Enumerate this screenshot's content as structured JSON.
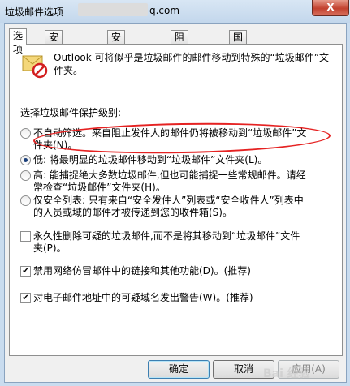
{
  "window": {
    "title": "垃圾邮件选项",
    "title_domain": "q.com",
    "close_label": "X"
  },
  "tabs": [
    {
      "label": "选项"
    },
    {
      "label": "安全发件人"
    },
    {
      "label": "安全收件人"
    },
    {
      "label": "阻止发件人"
    },
    {
      "label": "国际"
    }
  ],
  "intro": {
    "icon": "junk-mail-icon",
    "text": "Outlook 可将似乎是垃圾邮件的邮件移动到特殊的“垃圾邮件”文件夹。"
  },
  "protection": {
    "label": "选择垃圾邮件保护级别:",
    "options": [
      {
        "label": "不自动筛选。来自阻止发件人的邮件仍将被移动到“垃圾邮件”文件夹(N)。",
        "checked": false
      },
      {
        "label": "低: 将最明显的垃圾邮件移动到“垃圾邮件”文件夹(L)。",
        "checked": true
      },
      {
        "label": "高: 能捕捉绝大多数垃圾邮件,但也可能捕捉一些常规邮件。请经常检查“垃圾邮件”文件夹(H)。",
        "checked": false
      },
      {
        "label": "仅安全列表: 只有来自“安全发件人”列表或“安全收件人”列表中的人员或域的邮件才被传递到您的收件箱(S)。",
        "checked": false
      }
    ]
  },
  "checkboxes": [
    {
      "label": "永久性删除可疑的垃圾邮件,而不是将其移动到“垃圾邮件”文件夹(P)。",
      "checked": false
    },
    {
      "label": "禁用网络仿冒邮件中的链接和其他功能(D)。(推荐)",
      "checked": true
    },
    {
      "label": "对电子邮件地址中的可疑域名发出警告(W)。(推荐)",
      "checked": true
    }
  ],
  "buttons": {
    "ok": "确定",
    "cancel": "取消",
    "apply": "应用(A)"
  },
  "watermark": "Bai 经验",
  "colors": {
    "annotation_red": "#e52222",
    "close_red": "#c2412e"
  }
}
